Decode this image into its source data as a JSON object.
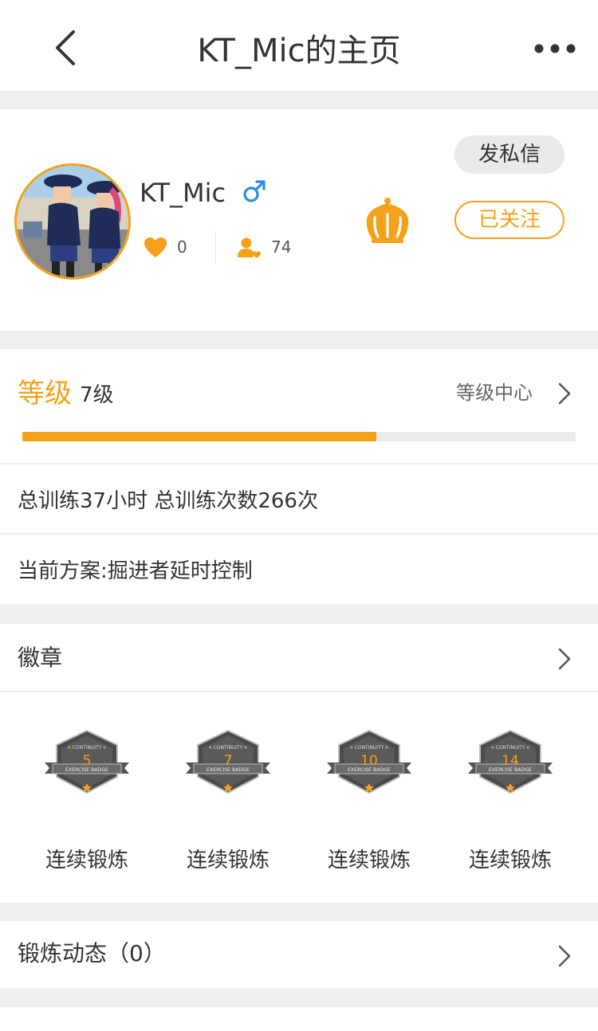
{
  "header": {
    "title": "KT_Mic的主页",
    "back_icon": "chevron-left-icon",
    "more_icon": "more-dots-icon"
  },
  "profile": {
    "username": "KT_Mic",
    "gender_icon": "male-icon",
    "likes": "0",
    "fans": "74",
    "crown_icon": "crown-icon",
    "message_button": "发私信",
    "follow_button": "已关注"
  },
  "level": {
    "label": "等级",
    "value": "7级",
    "center_link": "等级中心",
    "progress": 0.64
  },
  "stats": {
    "training_summary": "总训练37小时  总训练次数266次",
    "current_plan": "当前方案:掘进者延时控制"
  },
  "badges": {
    "title": "徽章",
    "items": [
      {
        "label": "连续锻炼",
        "number": "5",
        "top_text": "CONTINUITY",
        "ribbon_text": "EXERCISE BADGE"
      },
      {
        "label": "连续锻炼",
        "number": "7",
        "top_text": "CONTINUITY",
        "ribbon_text": "EXERCISE BADGE"
      },
      {
        "label": "连续锻炼",
        "number": "10",
        "top_text": "CONTINUITY",
        "ribbon_text": "EXERCISE BADGE"
      },
      {
        "label": "连续锻炼",
        "number": "14",
        "top_text": "CONTINUITY",
        "ribbon_text": "EXERCISE BADGE"
      }
    ]
  },
  "activity": {
    "title": "锻炼动态（0）"
  },
  "colors": {
    "accent": "#f5a11a",
    "gender_blue": "#2a8ee0",
    "background": "#efefef"
  }
}
